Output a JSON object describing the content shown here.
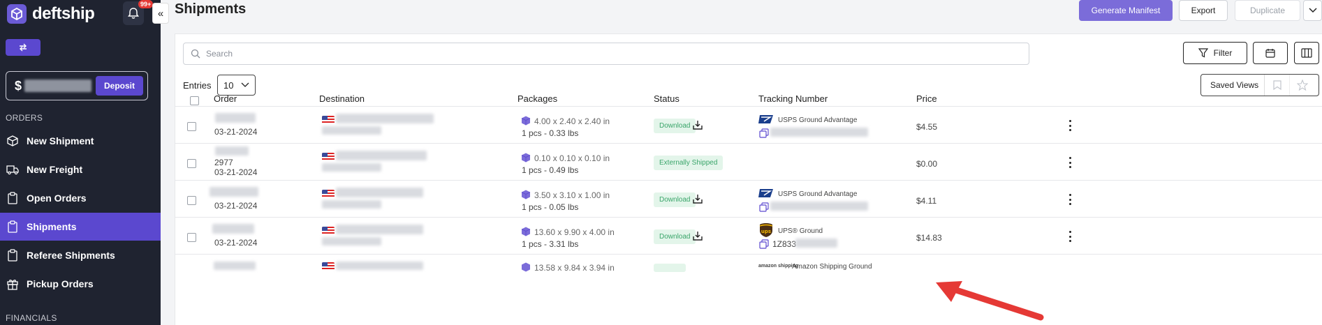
{
  "sidebar": {
    "brand": "deftship",
    "notification_count": "99+",
    "balance_currency": "$",
    "deposit_label": "Deposit",
    "orders_section": "ORDERS",
    "financials_section": "FINANCIALS",
    "items": [
      {
        "label": "New Shipment",
        "icon": "box-icon"
      },
      {
        "label": "New Freight",
        "icon": "truck-icon"
      },
      {
        "label": "Open Orders",
        "icon": "clipboard-icon"
      },
      {
        "label": "Shipments",
        "icon": "clipboard-icon",
        "active": true
      },
      {
        "label": "Referee Shipments",
        "icon": "clipboard-icon"
      },
      {
        "label": "Pickup Orders",
        "icon": "gift-icon"
      }
    ]
  },
  "header": {
    "title": "Shipments",
    "generate_manifest": "Generate Manifest",
    "export": "Export",
    "duplicate": "Duplicate"
  },
  "toolbar": {
    "search_placeholder": "Search",
    "filter": "Filter",
    "entries_label": "Entries",
    "entries_value": "10",
    "saved_views": "Saved Views"
  },
  "table": {
    "columns": [
      "Order",
      "Destination",
      "Packages",
      "Status",
      "Tracking Number",
      "Price"
    ],
    "rows": [
      {
        "order_id": "",
        "date": "03-21-2024",
        "dims": "4.00 x 2.40 x 2.40 in",
        "pkg": "1 pcs - 0.33 lbs",
        "status": "Download",
        "carrier": "USPS Ground Advantage",
        "carrier_logo": "usps",
        "tracking": "",
        "price": "$4.55"
      },
      {
        "order_id": "2977",
        "date": "03-21-2024",
        "dims": "0.10 x 0.10 x 0.10 in",
        "pkg": "1 pcs - 0.49 lbs",
        "status": "Externally Shipped",
        "carrier": "",
        "carrier_logo": "",
        "tracking": "",
        "price": "$0.00"
      },
      {
        "order_id": "",
        "date": "03-21-2024",
        "dims": "3.50 x 3.10 x 1.00 in",
        "pkg": "1 pcs - 0.05 lbs",
        "status": "Download",
        "carrier": "USPS Ground Advantage",
        "carrier_logo": "usps",
        "tracking": "",
        "price": "$4.11"
      },
      {
        "order_id": "",
        "date": "03-21-2024",
        "dims": "13.60 x 9.90 x 4.00 in",
        "pkg": "1 pcs - 3.31 lbs",
        "status": "Download",
        "carrier": "UPS® Ground",
        "carrier_logo": "ups",
        "tracking": "1Z833",
        "price": "$14.83"
      },
      {
        "order_id": "",
        "date": "",
        "dims": "13.58 x 9.84 x 3.94 in",
        "pkg": "",
        "status": "",
        "carrier": "Amazon Shipping Ground",
        "carrier_logo": "amazon shipping",
        "tracking": "",
        "price": ""
      }
    ]
  },
  "colors": {
    "sidebar_bg": "#1f2330",
    "accent": "#5b48cf",
    "badge_bg": "#e3f5ea",
    "badge_text": "#3aa56a",
    "annotation_arrow": "#e53935"
  }
}
